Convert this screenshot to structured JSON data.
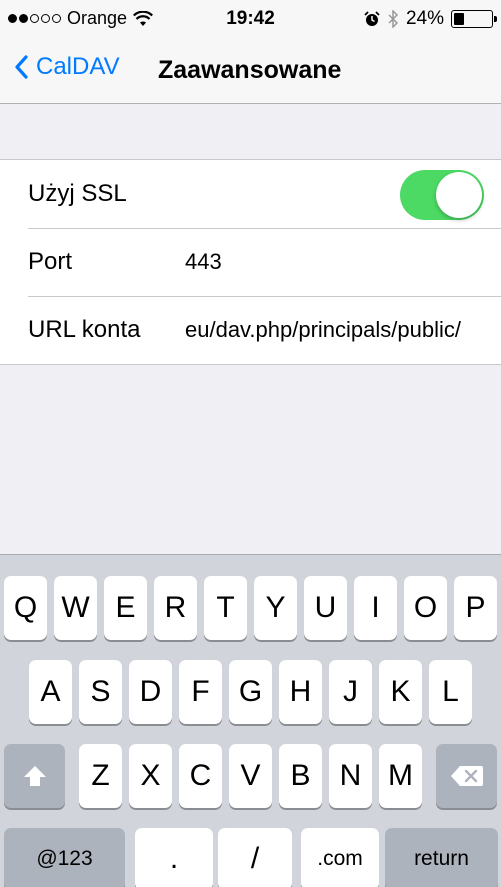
{
  "status_bar": {
    "signal_filled": 2,
    "signal_total": 5,
    "carrier": "Orange",
    "time": "19:42",
    "battery_percent": "24%",
    "battery_level": 0.24,
    "icons": [
      "wifi-icon",
      "alarm-icon",
      "bluetooth-icon",
      "battery-icon"
    ]
  },
  "nav": {
    "back_label": "CalDAV",
    "title": "Zaawansowane"
  },
  "settings": {
    "ssl_label": "Użyj SSL",
    "ssl_enabled": true,
    "port_label": "Port",
    "port_value": "443",
    "url_label": "URL konta",
    "url_value": "eu/dav.php/principals/public/"
  },
  "keyboard": {
    "row1": [
      "Q",
      "W",
      "E",
      "R",
      "T",
      "Y",
      "U",
      "I",
      "O",
      "P"
    ],
    "row2": [
      "A",
      "S",
      "D",
      "F",
      "G",
      "H",
      "J",
      "K",
      "L"
    ],
    "row3": [
      "Z",
      "X",
      "C",
      "V",
      "B",
      "N",
      "M"
    ],
    "numbers_label": "@123",
    "dot_label": ".",
    "slash_label": "/",
    "com_label": ".com",
    "return_label": "return"
  },
  "colors": {
    "accent": "#007aff",
    "toggle_on": "#4cd964",
    "background": "#efeff4",
    "keyboard_bg": "#d1d5db",
    "dark_key": "#adb3bc"
  }
}
